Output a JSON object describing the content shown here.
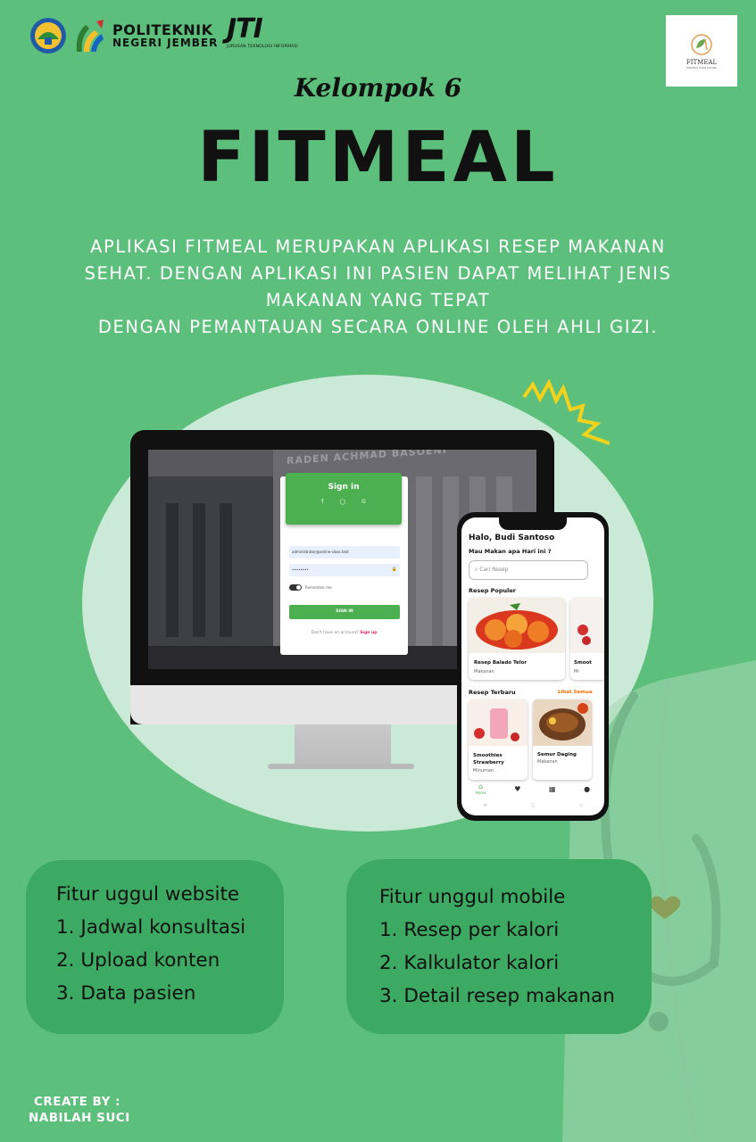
{
  "header": {
    "institution_line1": "POLITEKNIK",
    "institution_line2": "NEGERI JEMBER",
    "department_short": "JTI",
    "department_full": "JURUSAN TEKNOLOGI INFORMASI",
    "app_logo_text": "FITMEAL",
    "app_logo_tagline": "healthy food recipe"
  },
  "group": "Kelompok 6",
  "title": "FITMEAL",
  "description_lines": [
    "APLIKASI FITMEAL MERUPAKAN APLIKASI RESEP MAKANAN",
    "SEHAT.  DENGAN APLIKASI INI PASIEN DAPAT MELIHAT JENIS",
    "MAKANAN YANG TEPAT",
    "DENGAN PEMANTAUAN SECARA ONLINE OLEH AHLI GIZI."
  ],
  "website": {
    "building_sign": "RADEN ACHMAD BASOENI",
    "signin_title": "Sign in",
    "social_icons": [
      "f",
      "◯",
      "G"
    ],
    "email_value": "administrator@online-class.test",
    "password_value": "••••••••",
    "remember_label": "Remember me",
    "signin_button": "SIGN IN",
    "no_account_text": "Don't have an account?",
    "signup_link": "Sign up"
  },
  "mobile": {
    "greeting": "Halo, Budi Santoso",
    "question": "Mau Makan apa Hari ini ?",
    "search_placeholder": "Cari Resep",
    "popular_title": "Resep Populer",
    "popular_items": [
      {
        "name": "Resep Balado Telor",
        "category": "Makanan"
      },
      {
        "name": "Smoot",
        "category": "Mi"
      }
    ],
    "newest_title": "Resep Terbaru",
    "see_all": "Lihat Semua",
    "newest_items": [
      {
        "name": "Smoothies Strawberry",
        "category": "Minuman"
      },
      {
        "name": "Semur Daging",
        "category": "Makanan"
      }
    ],
    "nav_home": "Home",
    "colors": {
      "primary": "#4caf50",
      "accent": "#ff6f00"
    }
  },
  "features_web": {
    "title": "Fitur uggul website",
    "items": [
      "1. Jadwal konsultasi",
      "2. Upload konten",
      "3. Data pasien"
    ]
  },
  "features_mobile": {
    "title": "Fitur unggul mobile",
    "items": [
      "1. Resep per kalori",
      "2. Kalkulator kalori",
      "3. Detail resep makanan"
    ]
  },
  "credit": {
    "label": "CREATE BY :",
    "name": "NABILAH SUCI"
  },
  "colors": {
    "background": "#5cbf7c",
    "feature_box": "#3caa62",
    "oval": "#d6ede0"
  }
}
